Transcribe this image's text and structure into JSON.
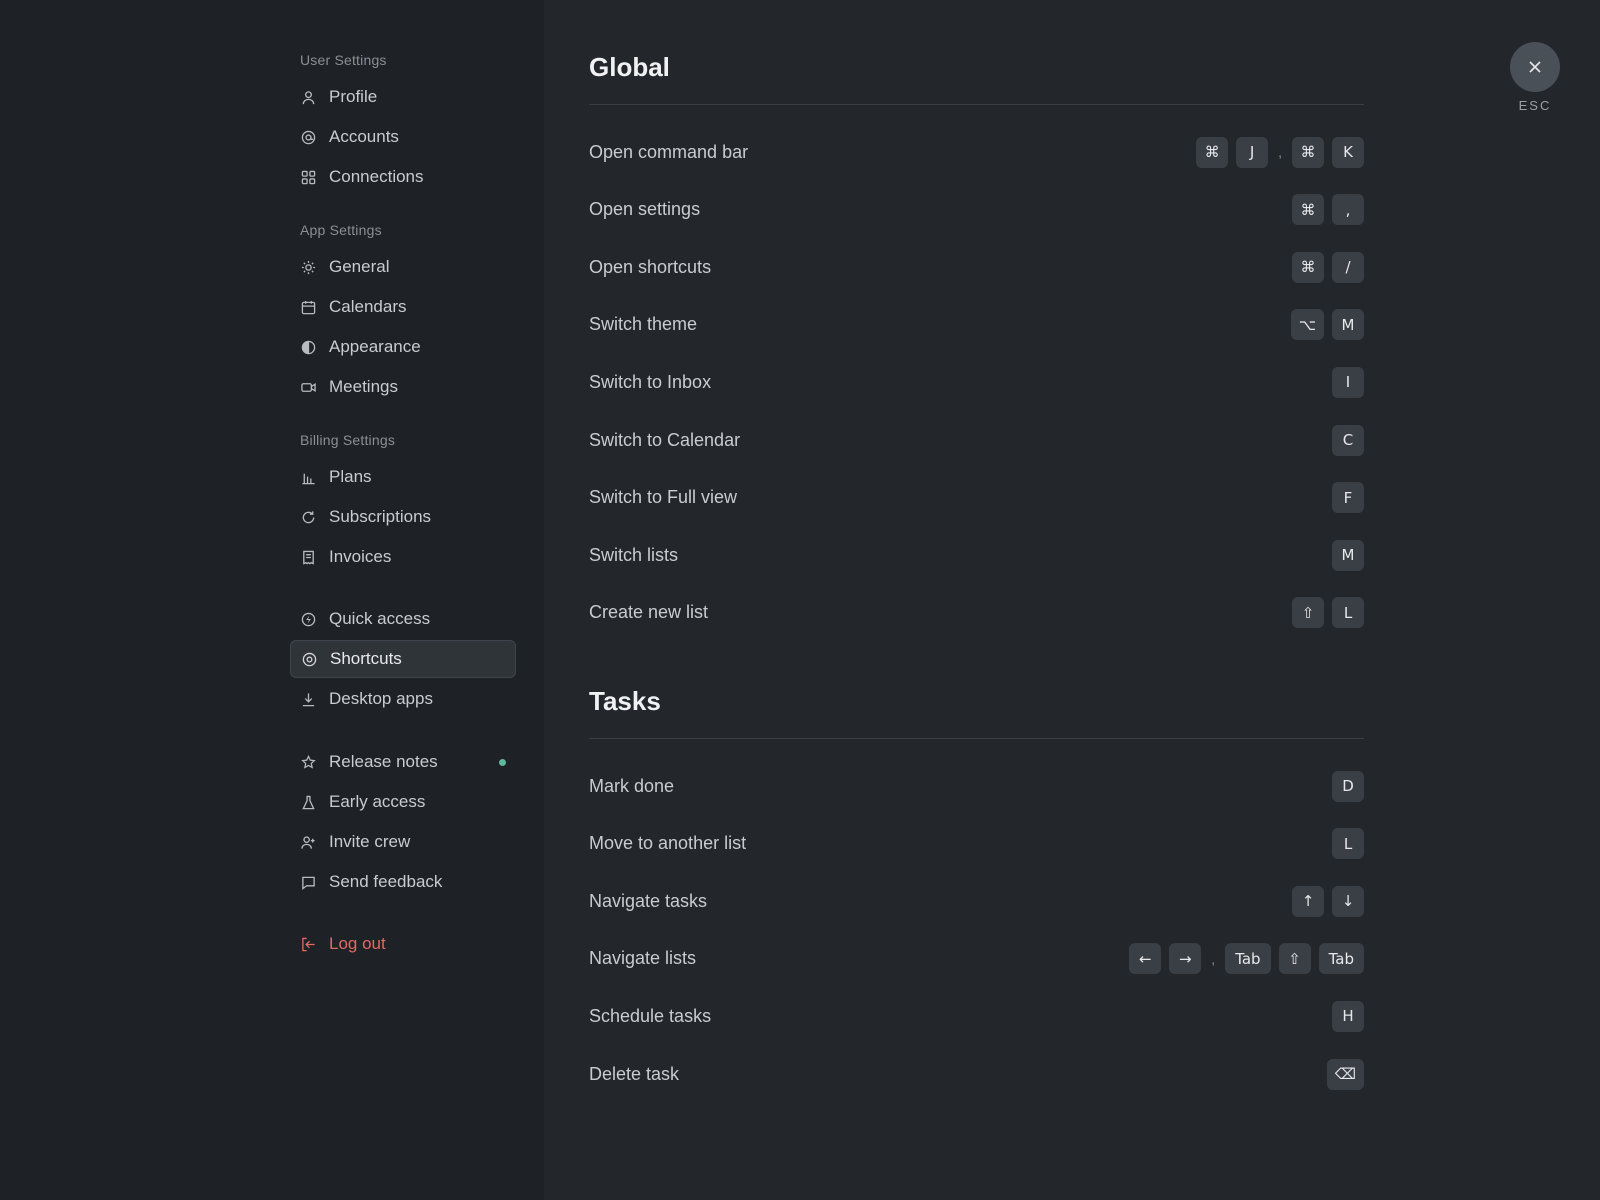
{
  "sidebar": {
    "user_settings_title": "User Settings",
    "app_settings_title": "App Settings",
    "billing_settings_title": "Billing Settings",
    "items": {
      "profile": "Profile",
      "accounts": "Accounts",
      "connections": "Connections",
      "general": "General",
      "calendars": "Calendars",
      "appearance": "Appearance",
      "meetings": "Meetings",
      "plans": "Plans",
      "subscriptions": "Subscriptions",
      "invoices": "Invoices",
      "quick_access": "Quick access",
      "shortcuts": "Shortcuts",
      "desktop_apps": "Desktop apps",
      "release_notes": "Release notes",
      "early_access": "Early access",
      "invite_crew": "Invite crew",
      "send_feedback": "Send feedback",
      "log_out": "Log out"
    },
    "active_item": "Shortcuts",
    "colors": {
      "logout": "#e06a64",
      "new_dot": "#5fb89a"
    }
  },
  "global": {
    "title": "Global",
    "rows": [
      {
        "label": "Open command bar",
        "keys": [
          "⌘",
          "J",
          ",",
          "⌘",
          "K"
        ]
      },
      {
        "label": "Open settings",
        "keys": [
          "⌘",
          ","
        ]
      },
      {
        "label": "Open shortcuts",
        "keys": [
          "⌘",
          "/"
        ]
      },
      {
        "label": "Switch theme",
        "keys": [
          "⌥",
          "M"
        ]
      },
      {
        "label": "Switch to Inbox",
        "keys": [
          "I"
        ]
      },
      {
        "label": "Switch to Calendar",
        "keys": [
          "C"
        ]
      },
      {
        "label": "Switch to Full view",
        "keys": [
          "F"
        ]
      },
      {
        "label": "Switch lists",
        "keys": [
          "M"
        ]
      },
      {
        "label": "Create new list",
        "keys": [
          "⇧",
          "L"
        ]
      }
    ]
  },
  "tasks": {
    "title": "Tasks",
    "rows": [
      {
        "label": "Mark done",
        "keys": [
          "D"
        ]
      },
      {
        "label": "Move to another list",
        "keys": [
          "L"
        ]
      },
      {
        "label": "Navigate tasks",
        "keys": [
          "↑",
          "↓"
        ]
      },
      {
        "label": "Navigate lists",
        "keys": [
          "←",
          "→",
          ",",
          "Tab",
          "⇧",
          "Tab"
        ]
      },
      {
        "label": "Schedule tasks",
        "keys": [
          "H"
        ]
      },
      {
        "label": "Delete task",
        "keys": [
          "⌫"
        ]
      }
    ]
  },
  "close": {
    "label": "ESC",
    "icon": "close-icon"
  }
}
